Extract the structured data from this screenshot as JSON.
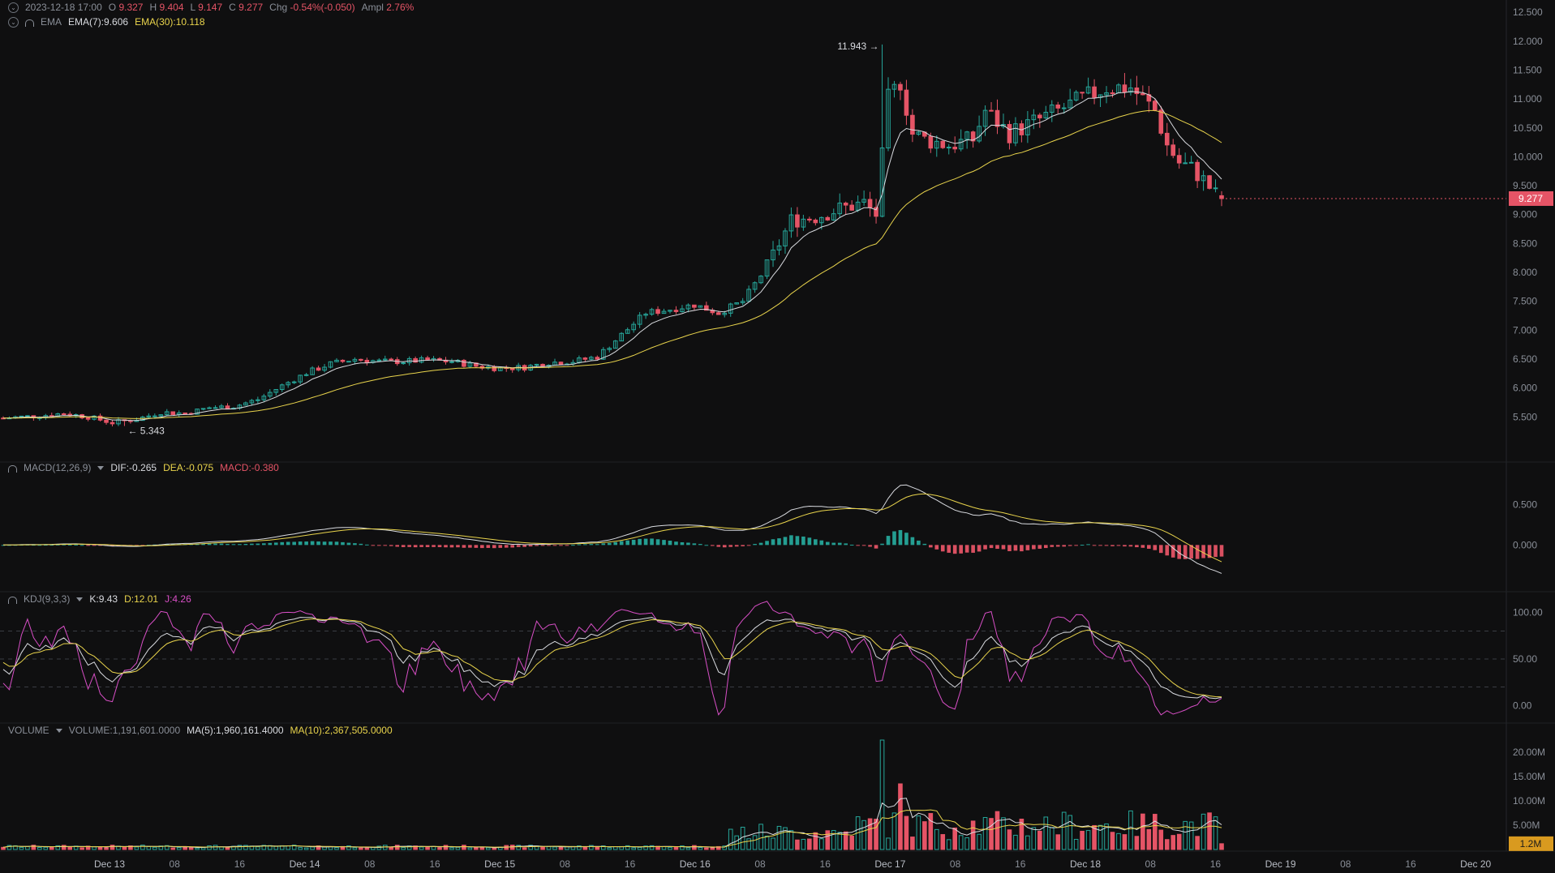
{
  "ohlc_bar": {
    "datetime": "2023-12-18 17:00",
    "open_label": "O",
    "open": "9.327",
    "high_label": "H",
    "high": "9.404",
    "low_label": "L",
    "low": "9.147",
    "close_label": "C",
    "close": "9.277",
    "chg_label": "Chg",
    "chg": "-0.54%(-0.050)",
    "ampl_label": "Ampl",
    "ampl": "2.76%"
  },
  "ema_legend": {
    "name": "EMA",
    "ema7": "EMA(7):9.606",
    "ema30": "EMA(30):10.118"
  },
  "macd_legend": {
    "name": "MACD(12,26,9)",
    "dif": "DIF:-0.265",
    "dea": "DEA:-0.075",
    "macd": "MACD:-0.380"
  },
  "kdj_legend": {
    "name": "KDJ(9,3,3)",
    "k": "K:9.43",
    "d": "D:12.01",
    "j": "J:4.26"
  },
  "volume_legend": {
    "name": "VOLUME",
    "vol": "VOLUME:1,191,601.0000",
    "ma5": "MA(5):1,960,161.4000",
    "ma10": "MA(10):2,367,505.0000"
  },
  "colors": {
    "up": "#26a69a",
    "down": "#e55466",
    "ema7": "#d9dbe0",
    "ema30": "#e9d44c",
    "j": "#d84fc6",
    "bg": "#0f0f10"
  },
  "chart_data": {
    "type": "candlestick",
    "price_axis_ticks": [
      "12.500",
      "12.000",
      "11.500",
      "11.000",
      "10.500",
      "10.000",
      "9.500",
      "9.000",
      "8.500",
      "8.000",
      "7.500",
      "7.000",
      "6.500",
      "6.000",
      "5.500"
    ],
    "price_ylim": [
      5.0,
      12.6
    ],
    "last_price_label": "9.277",
    "high_marker": "11.943 →",
    "low_marker": "← 5.343",
    "macd_axis_ticks": [
      "0.500",
      "0.000"
    ],
    "kdj_axis_ticks": [
      "100.00",
      "50.00",
      "0.00"
    ],
    "volume_axis_ticks": [
      "20.00M",
      "15.00M",
      "10.00M",
      "5.00M"
    ],
    "last_volume_label": "1.2M",
    "time_axis_ticks": [
      "Dec 13",
      "08",
      "16",
      "Dec 14",
      "08",
      "16",
      "Dec 15",
      "08",
      "16",
      "Dec 16",
      "08",
      "16",
      "Dec 17",
      "08",
      "16",
      "Dec 18",
      "08",
      "16",
      "Dec 19",
      "08",
      "16",
      "Dec 20"
    ],
    "price_path": [
      [
        0,
        5.48
      ],
      [
        6,
        5.52
      ],
      [
        10,
        5.56
      ],
      [
        14,
        5.5
      ],
      [
        18,
        5.4
      ],
      [
        22,
        5.46
      ],
      [
        26,
        5.58
      ],
      [
        30,
        5.56
      ],
      [
        34,
        5.66
      ],
      [
        38,
        5.68
      ],
      [
        42,
        5.8
      ],
      [
        46,
        6.04
      ],
      [
        50,
        6.26
      ],
      [
        54,
        6.42
      ],
      [
        58,
        6.5
      ],
      [
        62,
        6.46
      ],
      [
        66,
        6.46
      ],
      [
        70,
        6.48
      ],
      [
        74,
        6.46
      ],
      [
        78,
        6.38
      ],
      [
        82,
        6.34
      ],
      [
        86,
        6.36
      ],
      [
        90,
        6.44
      ],
      [
        94,
        6.46
      ],
      [
        98,
        6.54
      ],
      [
        102,
        6.92
      ],
      [
        106,
        7.3
      ],
      [
        110,
        7.36
      ],
      [
        114,
        7.44
      ],
      [
        118,
        7.3
      ],
      [
        122,
        7.5
      ],
      [
        126,
        8.1
      ],
      [
        130,
        8.9
      ],
      [
        134,
        8.96
      ],
      [
        138,
        9.1
      ],
      [
        142,
        9.2
      ],
      [
        144,
        9.0
      ],
      [
        146,
        11.0
      ],
      [
        148,
        11.3
      ],
      [
        150,
        10.4
      ],
      [
        152,
        10.3
      ],
      [
        156,
        10.2
      ],
      [
        160,
        10.3
      ],
      [
        162,
        10.8
      ],
      [
        166,
        10.4
      ],
      [
        170,
        10.6
      ],
      [
        174,
        10.8
      ],
      [
        178,
        11.0
      ],
      [
        182,
        11.2
      ],
      [
        186,
        11.2
      ],
      [
        188,
        11.0
      ],
      [
        190,
        10.8
      ],
      [
        192,
        10.2
      ],
      [
        194,
        9.9
      ],
      [
        196,
        9.8
      ],
      [
        198,
        9.6
      ],
      [
        200,
        9.35
      ],
      [
        201,
        9.277
      ]
    ],
    "volume_series": {
      "ma_windows": [
        5,
        10
      ],
      "last_volume": 1191601
    }
  }
}
